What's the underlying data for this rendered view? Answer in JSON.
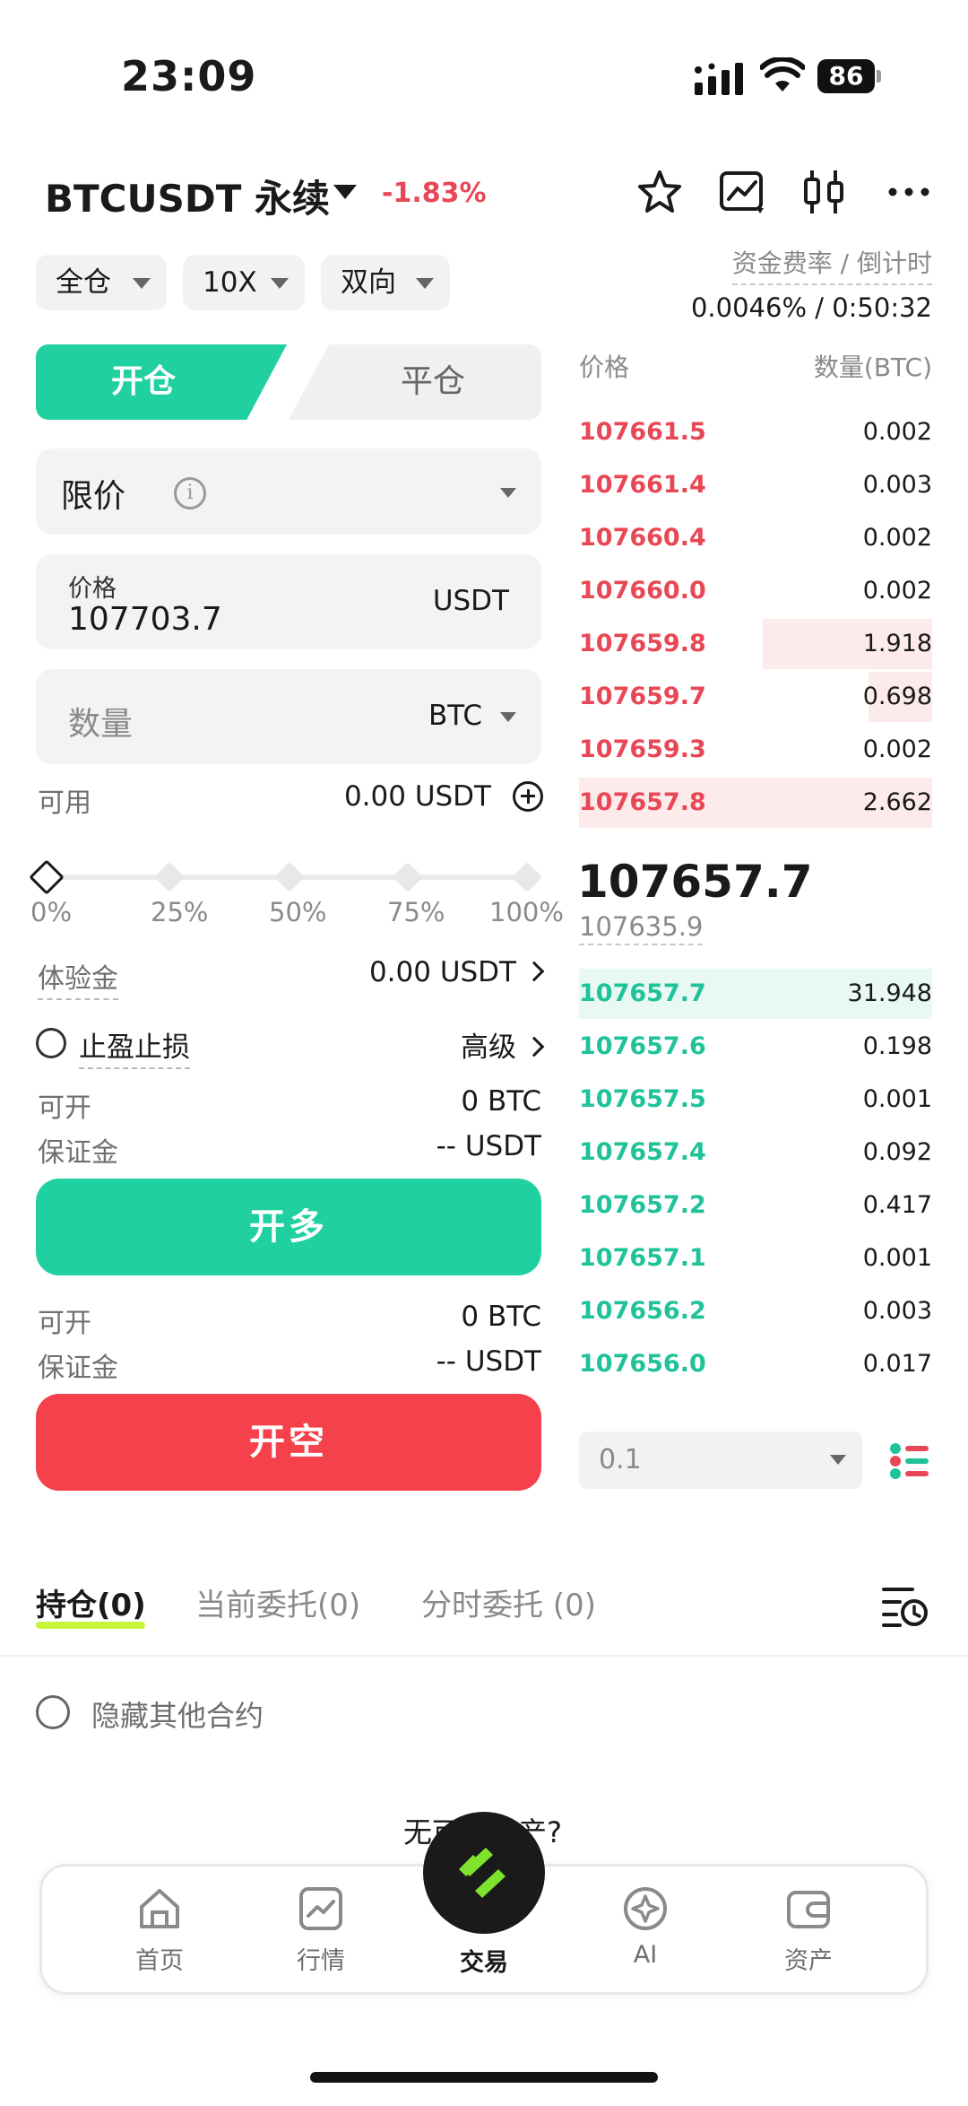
{
  "status": {
    "time": "23:09",
    "battery": "86"
  },
  "header": {
    "pair": "BTCUSDT 永续",
    "change": "-1.83%",
    "icons": [
      "star-icon",
      "chart-icon",
      "candlestick-icon",
      "more-icon"
    ]
  },
  "pills": {
    "margin_mode": "全仓",
    "leverage": "10X",
    "position_mode": "双向"
  },
  "funding": {
    "label": "资金费率 / 倒计时",
    "value": "0.0046% / 0:50:32"
  },
  "trade_tabs": {
    "open": "开仓",
    "close": "平仓"
  },
  "order_type": {
    "label": "限价"
  },
  "price_field": {
    "label": "价格",
    "value": "107703.7",
    "unit": "USDT"
  },
  "qty_field": {
    "placeholder": "数量",
    "unit": "BTC"
  },
  "available": {
    "label": "可用",
    "value": "0.00 USDT"
  },
  "slider": {
    "value": 0,
    "ticks": [
      "0%",
      "25%",
      "50%",
      "75%",
      "100%"
    ]
  },
  "bonus": {
    "label": "体验金",
    "value": "0.00 USDT"
  },
  "tpsl": {
    "label": "止盈止损",
    "advanced": "高级"
  },
  "long_info": {
    "can_open_label": "可开",
    "can_open_value": "0 BTC",
    "margin_label": "保证金",
    "margin_value": "-- USDT"
  },
  "long_button": "开多",
  "short_info": {
    "can_open_label": "可开",
    "can_open_value": "0 BTC",
    "margin_label": "保证金",
    "margin_value": "-- USDT"
  },
  "short_button": "开空",
  "orderbook": {
    "price_header": "价格",
    "qty_header": "数量(BTC)",
    "asks": [
      {
        "price": "107661.5",
        "qty": "0.002",
        "depth": 0
      },
      {
        "price": "107661.4",
        "qty": "0.003",
        "depth": 0
      },
      {
        "price": "107660.4",
        "qty": "0.002",
        "depth": 0
      },
      {
        "price": "107660.0",
        "qty": "0.002",
        "depth": 0
      },
      {
        "price": "107659.8",
        "qty": "1.918",
        "depth": 0.48
      },
      {
        "price": "107659.7",
        "qty": "0.698",
        "depth": 0.18
      },
      {
        "price": "107659.3",
        "qty": "0.002",
        "depth": 0
      },
      {
        "price": "107657.8",
        "qty": "2.662",
        "depth": 1.0
      }
    ],
    "last_price": "107657.7",
    "mark_price": "107635.9",
    "bids": [
      {
        "price": "107657.7",
        "qty": "31.948",
        "depth": 1.0
      },
      {
        "price": "107657.6",
        "qty": "0.198",
        "depth": 0
      },
      {
        "price": "107657.5",
        "qty": "0.001",
        "depth": 0
      },
      {
        "price": "107657.4",
        "qty": "0.092",
        "depth": 0
      },
      {
        "price": "107657.2",
        "qty": "0.417",
        "depth": 0
      },
      {
        "price": "107657.1",
        "qty": "0.001",
        "depth": 0
      },
      {
        "price": "107656.2",
        "qty": "0.003",
        "depth": 0
      },
      {
        "price": "107656.0",
        "qty": "0.017",
        "depth": 0
      }
    ],
    "precision": "0.1"
  },
  "position_tabs": [
    "持仓(0)",
    "当前委托(0)",
    "分时委托 (0)"
  ],
  "hide_other": "隐藏其他合约",
  "peek_text": "无可用资产?",
  "nav": {
    "home": "首页",
    "market": "行情",
    "trade": "交易",
    "ai": "AI",
    "assets": "资产"
  },
  "colors": {
    "green": "#20d0a1",
    "red": "#f5414b",
    "accent": "#c8f53c"
  }
}
